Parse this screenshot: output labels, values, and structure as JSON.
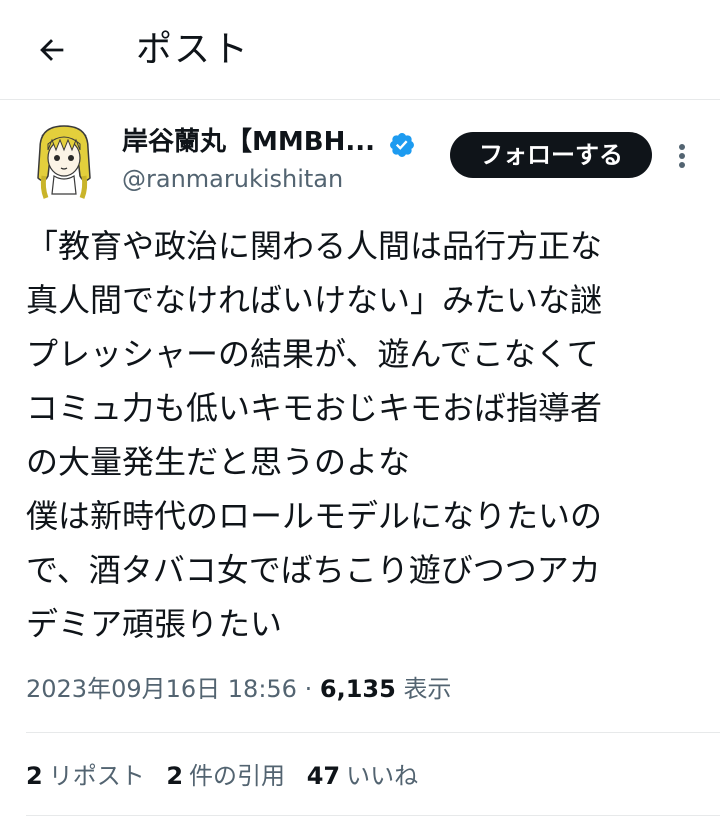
{
  "header": {
    "title": "ポスト",
    "back_icon": "arrow-left-icon"
  },
  "author": {
    "name": "岸谷蘭丸【MMBH...",
    "handle": "@ranmarukishitan",
    "verified_icon": "verified-badge-icon",
    "verified_color": "#1d9bf0"
  },
  "follow_label": "フォローする",
  "more_icon": "more-vertical-icon",
  "tweet": {
    "lines": [
      "「教育や政治に関わる人間は品行方正な",
      "真人間でなければいけない」みたいな謎",
      "プレッシャーの結果が、遊んでこなくて",
      "コミュ力も低いキモおじキモおば指導者",
      "の大量発生だと思うのよな",
      "僕は新時代のロールモデルになりたいの",
      "で、酒タバコ女でばちこり遊びつつアカ",
      "デミア頑張りたい"
    ]
  },
  "meta": {
    "timestamp": "2023年09月16日 18:56",
    "separator": "·",
    "views_count": "6,135",
    "views_label": "表示"
  },
  "stats": [
    {
      "count": "2",
      "label": "リポスト"
    },
    {
      "count": "2",
      "label": "件の引用"
    },
    {
      "count": "47",
      "label": "いいね"
    }
  ]
}
